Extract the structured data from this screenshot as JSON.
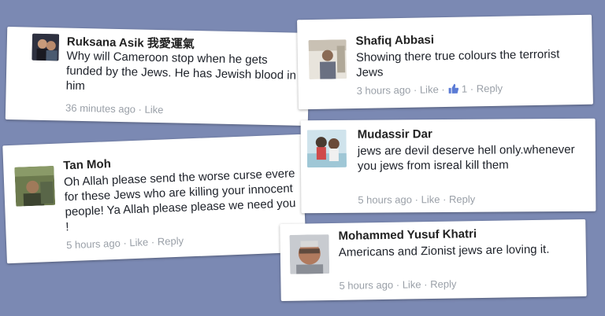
{
  "comments": [
    {
      "name": "Ruksana Asik 我愛運氣",
      "text": "Why will Cameroon stop when he gets funded by the Jews. He has Jewish blood in him",
      "time": "36 minutes ago",
      "like": "Like"
    },
    {
      "name": "Shafiq Abbasi",
      "text": "Showing there true colours the terrorist Jews",
      "time": "3 hours ago",
      "like": "Like",
      "like_count": "1",
      "reply": "Reply"
    },
    {
      "name": "Tan Moh",
      "text": "Oh Allah please send the worse curse evere for these Jews who are killing your innocent people! Ya Allah please please we need you !",
      "time": "5 hours ago",
      "like": "Like",
      "reply": "Reply"
    },
    {
      "name": "Mudassir Dar",
      "text": "jews are devil deserve hell only.whenever you jews from isreal kill them",
      "time": "5 hours ago",
      "like": "Like",
      "reply": "Reply"
    },
    {
      "name": "Mohammed Yusuf Khatri",
      "text": "Americans and Zionist jews are loving it.",
      "time": "5 hours ago",
      "like": "Like",
      "reply": "Reply"
    }
  ],
  "separator": "·",
  "colors": {
    "background": "#7b89b3",
    "meta": "#9aa0a8",
    "like_thumb": "#5b7bd5"
  }
}
